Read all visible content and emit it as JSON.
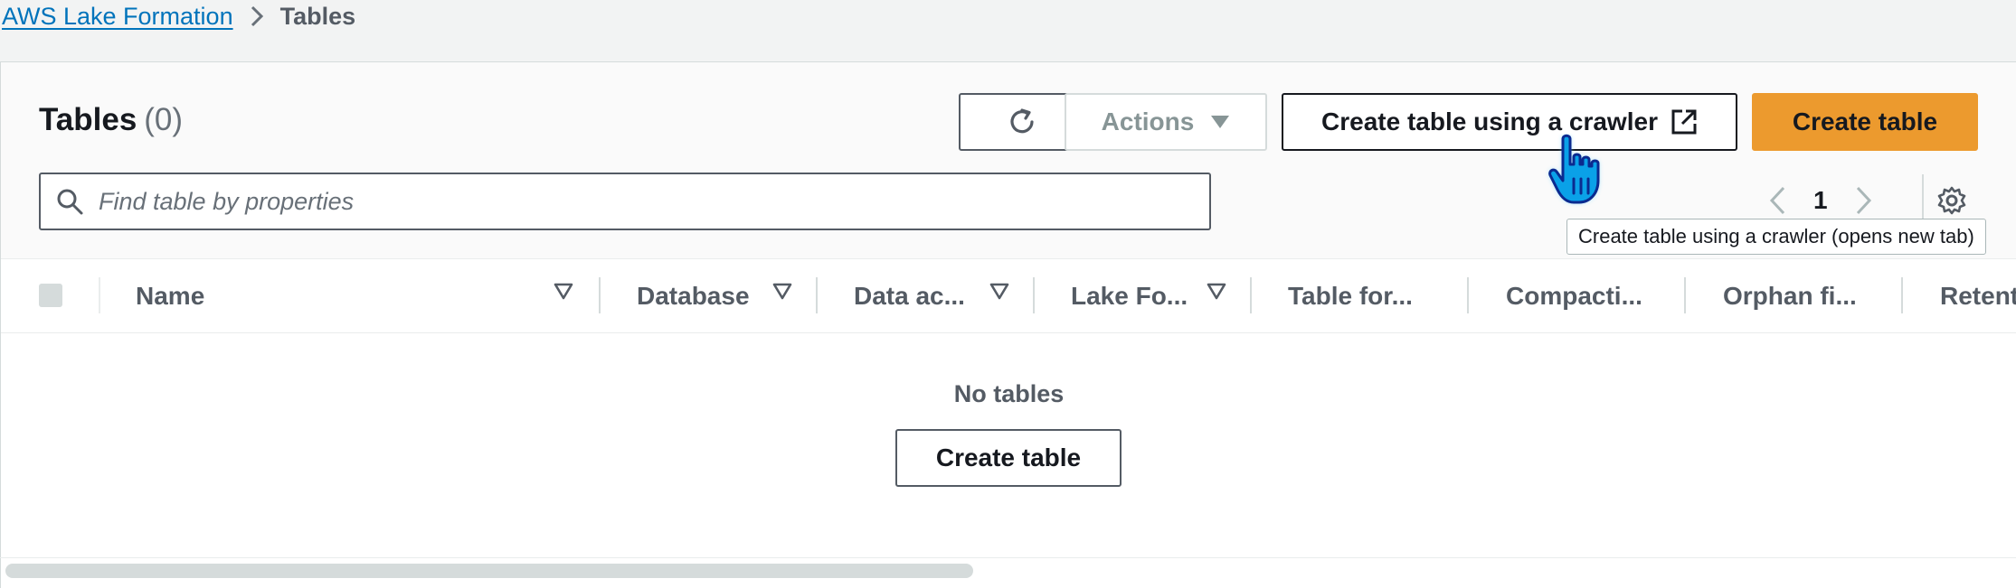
{
  "breadcrumb": {
    "root": "AWS Lake Formation",
    "current": "Tables"
  },
  "header": {
    "title": "Tables",
    "count": "(0)"
  },
  "toolbar": {
    "refresh_icon": "refresh-icon",
    "actions_label": "Actions",
    "crawler_label": "Create table using a crawler",
    "create_label": "Create table"
  },
  "search": {
    "placeholder": "Find table by properties"
  },
  "pagination": {
    "page": "1"
  },
  "tooltip": {
    "text": "Create table using a crawler (opens new tab)"
  },
  "table": {
    "columns": [
      "Name",
      "Database",
      "Data ac...",
      "Lake Fo...",
      "Table for...",
      "Compacti...",
      "Orphan fi...",
      "Retent"
    ]
  },
  "empty_state": {
    "title": "No tables",
    "button_label": "Create table"
  },
  "colors": {
    "primary_button": "#ec9a2e",
    "link": "#0073bb",
    "cursor": "#0aa1e8"
  }
}
